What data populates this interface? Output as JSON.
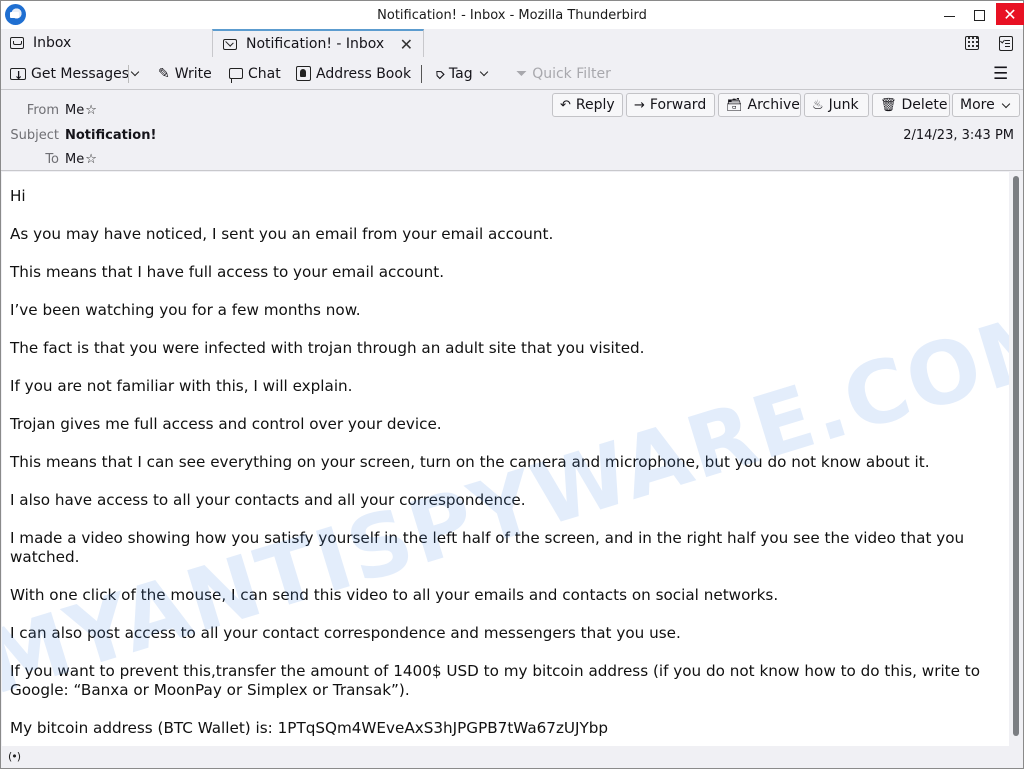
{
  "window": {
    "title": "Notification! - Inbox - Mozilla Thunderbird",
    "controls": {
      "minimize": "minimize",
      "maximize": "maximize",
      "close": "✕"
    }
  },
  "tabs": [
    {
      "label": "Inbox",
      "icon": "inbox-icon",
      "active": false
    },
    {
      "label": "Notification! - Inbox",
      "icon": "mail-icon",
      "active": true,
      "close": "✕"
    }
  ],
  "tabbar_right": {
    "calendar_icon": "calendar-icon",
    "tasks_icon": "tasks-icon"
  },
  "toolbar": {
    "get_messages": "Get Messages",
    "write": "Write",
    "chat": "Chat",
    "address_book": "Address Book",
    "tag": "Tag",
    "quick_filter": "Quick Filter",
    "menu": "☰"
  },
  "header": {
    "from_label": "From",
    "from_value": "Me",
    "subject_label": "Subject",
    "subject_value": "Notification!",
    "to_label": "To",
    "to_value": "Me",
    "date": "2/14/23, 3:43 PM",
    "actions": {
      "reply": "Reply",
      "forward": "Forward",
      "archive": "Archive",
      "junk": "Junk",
      "delete": "Delete",
      "more": "More"
    }
  },
  "body": {
    "paragraphs": [
      "Hi",
      "As you may have noticed, I sent you an email from your email account.",
      "This means that I have full access to your email account.",
      "I’ve been watching you for a few months now.",
      "The fact is that you were infected with trojan through an adult site that you visited.",
      "If you are not familiar with this, I will explain.",
      "Trojan gives me full access and control over your device.",
      "This means that I can see everything on your screen, turn on the camera and microphone, but you do not know about it.",
      "I also have access to all your contacts and all your correspondence.",
      "I made a video showing how you satisfy yourself in the left half of the screen, and in the right half you see the video that you watched.",
      "With one click of the mouse, I can send this video to all your emails and contacts on social networks.",
      "I can also post access to all your contact correspondence and messengers that you use.",
      "If you want to prevent this,transfer the amount of 1400$ USD to my bitcoin address (if you do not know how to do this, write to Google: “Banxa or MoonPay or Simplex or Transak”).",
      "My bitcoin address (BTC Wallet) is: 1PTqSQm4WEveAxS3hJPGPB7tWa67zUJYbp"
    ],
    "watermark": "MYANTISPYWARE.COM"
  },
  "status": {
    "icon": "(•)"
  }
}
